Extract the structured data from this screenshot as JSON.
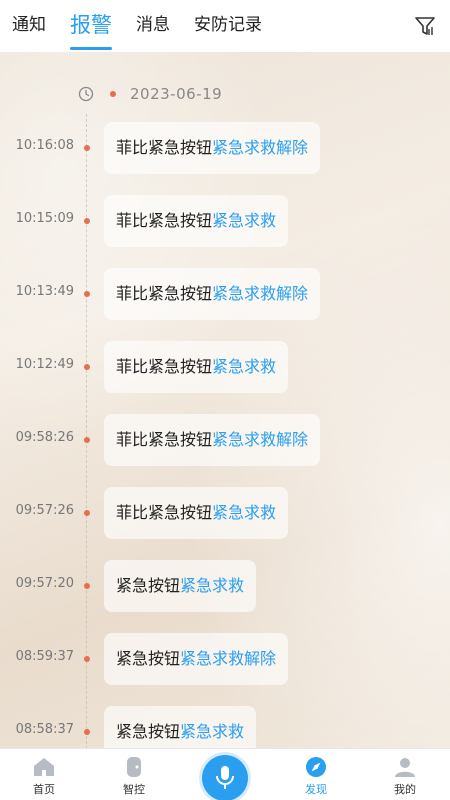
{
  "top_tabs": [
    {
      "label": "通知",
      "active": false
    },
    {
      "label": "报警",
      "active": true
    },
    {
      "label": "消息",
      "active": false
    },
    {
      "label": "安防记录",
      "active": false
    }
  ],
  "filter_icon": "filter-icon",
  "timeline": {
    "date": "2023-06-19",
    "events": [
      {
        "time": "10:16:08",
        "device": "菲比紧急按钮",
        "state": "紧急求救解除"
      },
      {
        "time": "10:15:09",
        "device": "菲比紧急按钮",
        "state": "紧急求救"
      },
      {
        "time": "10:13:49",
        "device": "菲比紧急按钮",
        "state": "紧急求救解除"
      },
      {
        "time": "10:12:49",
        "device": "菲比紧急按钮",
        "state": "紧急求救"
      },
      {
        "time": "09:58:26",
        "device": "菲比紧急按钮",
        "state": "紧急求救解除"
      },
      {
        "time": "09:57:26",
        "device": "菲比紧急按钮",
        "state": "紧急求救"
      },
      {
        "time": "09:57:20",
        "device": "紧急按钮",
        "state": "紧急求救"
      },
      {
        "time": "08:59:37",
        "device": "紧急按钮",
        "state": "紧急求救解除"
      },
      {
        "time": "08:58:37",
        "device": "紧急按钮",
        "state": "紧急求救"
      }
    ]
  },
  "bottom_nav": {
    "home": {
      "label": "首页",
      "icon": "house-icon"
    },
    "control": {
      "label": "智控",
      "icon": "device-icon"
    },
    "voice": {
      "icon": "microphone-icon"
    },
    "discover": {
      "label": "发现",
      "icon": "compass-icon",
      "active": true
    },
    "mine": {
      "label": "我的",
      "icon": "person-icon"
    }
  },
  "colors": {
    "accent": "#2a9ff0",
    "timeline_dot": "#e4704d",
    "text": "#222222",
    "muted": "#777777"
  }
}
